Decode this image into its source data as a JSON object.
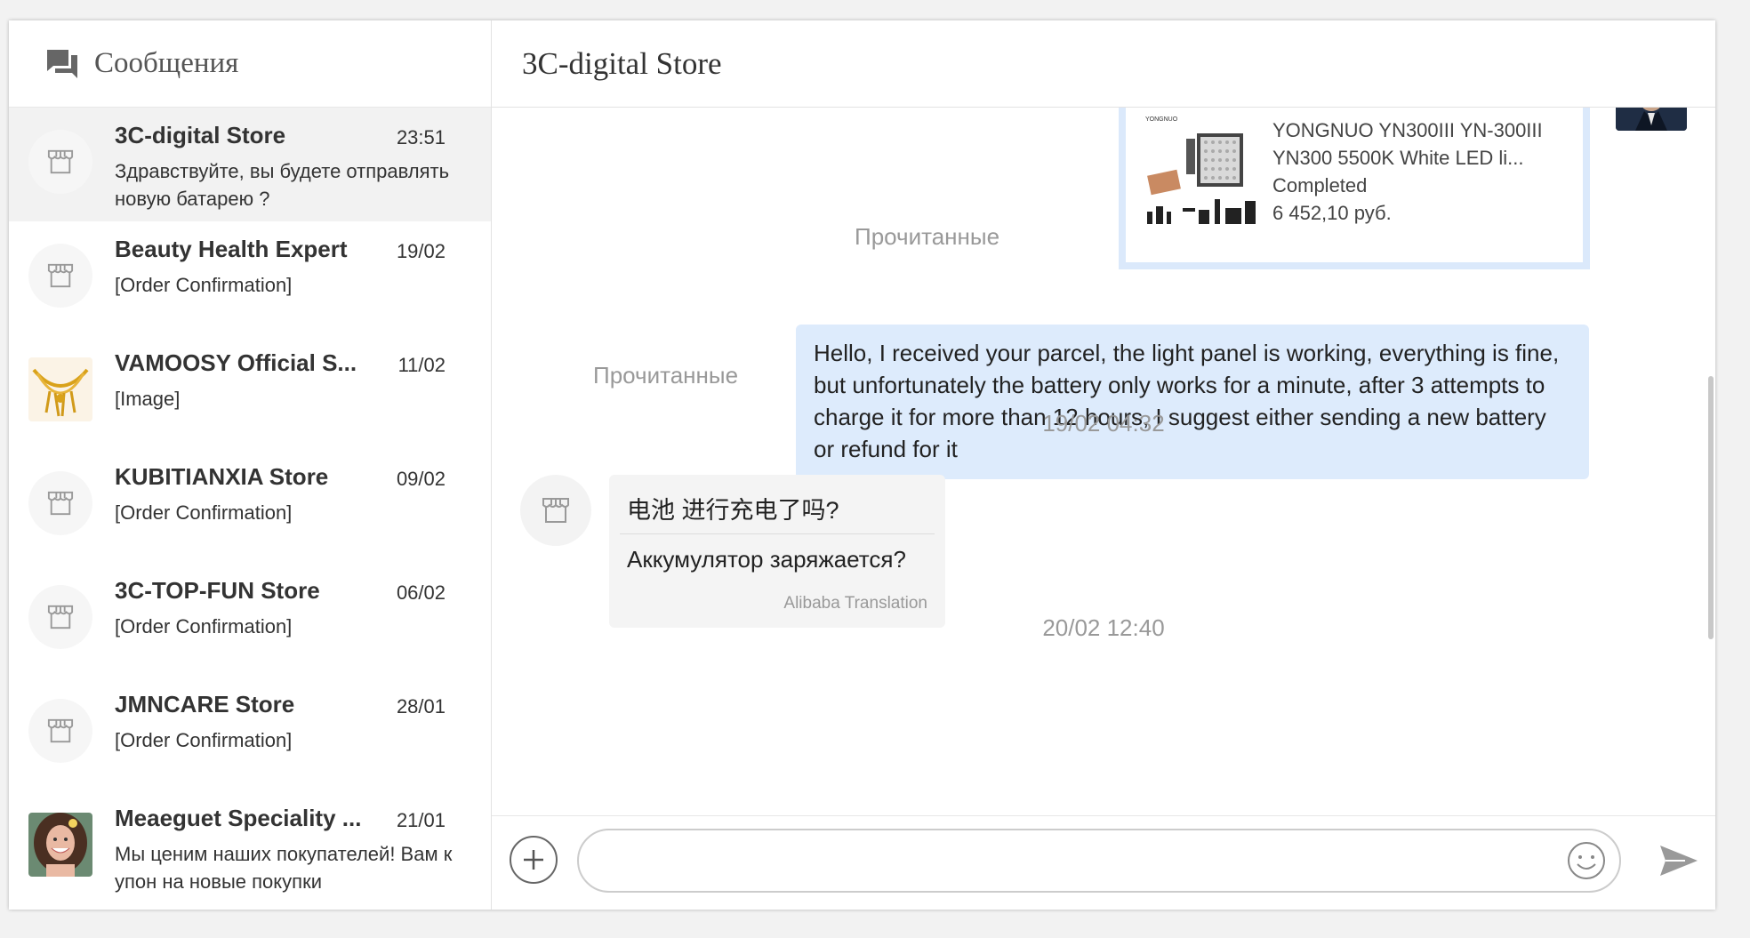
{
  "sidebar": {
    "title": "Сообщения",
    "conversations": [
      {
        "name": "3C-digital Store",
        "time": "23:51",
        "preview": "Здравствуйте, вы будете отправлять новую батарею ?",
        "active": true,
        "avatar": "store-icon"
      },
      {
        "name": "Beauty Health Expert",
        "time": "19/02",
        "preview": "[Order Confirmation]",
        "avatar": "store-icon"
      },
      {
        "name": "VAMOOSY Official S...",
        "time": "11/02",
        "preview": "[Image]",
        "avatar": "jewelry-photo"
      },
      {
        "name": "KUBITIANXIA Store",
        "time": "09/02",
        "preview": "[Order Confirmation]",
        "avatar": "store-icon"
      },
      {
        "name": "3C-TOP-FUN Store",
        "time": "06/02",
        "preview": "[Order Confirmation]",
        "avatar": "store-icon"
      },
      {
        "name": "JMNCARE Store",
        "time": "28/01",
        "preview": "[Order Confirmation]",
        "avatar": "store-icon"
      },
      {
        "name": "Meaeguet Speciality ...",
        "time": "21/01",
        "preview": "Мы ценим наших покупателей! Вам купон на новые покупки",
        "avatar": "woman-photo"
      }
    ]
  },
  "chat": {
    "title": "3C-digital Store",
    "read_label": "Прочитанные",
    "product_card": {
      "brand": "YONGNUO",
      "title": "YONGNUO YN300III YN-300III YN300 5500K White LED li...",
      "status": "Completed",
      "price": "6 452,10 руб."
    },
    "my_message": "Hello, I received your parcel, the light panel is working, everything is fine, but unfortunately the battery only works for a minute, after 3 attempts to charge it for more than 12 hours, I suggest either sending a new battery or refund for it",
    "stamp1": "19/02 04:32",
    "incoming": {
      "original": "电池 进行充电了吗?",
      "translation": "Аккумулятор заряжается?",
      "translator": "Alibaba Translation"
    },
    "stamp2": "20/02 12:40"
  },
  "composer": {
    "placeholder": ""
  },
  "colors": {
    "my_bubble": "#ddebfc",
    "incoming_bubble": "#f4f4f4",
    "active_conversation": "#f2f2f2"
  }
}
